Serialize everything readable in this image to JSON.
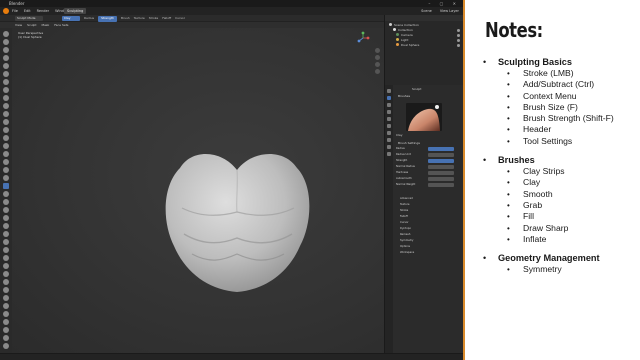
{
  "blender": {
    "title": "Blender",
    "menu": [
      "File",
      "Edit",
      "Render",
      "Window",
      "Help"
    ],
    "workspace": "Sculpting",
    "header_right": [
      "Scene",
      "View Layer"
    ],
    "tool_header": {
      "mode": "Sculpt Mode",
      "brush": "Clay",
      "fields": [
        "Radius",
        "Strength",
        "Brush",
        "Texture",
        "Stroke",
        "Falloff",
        "Cursor"
      ]
    },
    "viewport_header": [
      "View",
      "Sculpt",
      "Mask",
      "Face Sets"
    ],
    "viewport_info": [
      "User Perspective",
      "(1) Dual Sphere"
    ],
    "outliner": [
      {
        "label": "Scene Collection",
        "color": "#cccccc"
      },
      {
        "label": "Collection",
        "color": "#e0e0e0"
      },
      {
        "label": "Camera",
        "color": "#5b8d5b"
      },
      {
        "label": "Light",
        "color": "#d4b04a"
      },
      {
        "label": "Dual Sphere",
        "color": "#e89b40"
      }
    ],
    "properties": {
      "tool_name": "Sculpt",
      "brushes_label": "Brushes",
      "brush_name": "Clay",
      "brush_settings": "Brush Settings",
      "rows": [
        {
          "label": "Radius",
          "value": ""
        },
        {
          "label": "Radius Unit",
          "value": ""
        },
        {
          "label": "Strength",
          "value": ""
        },
        {
          "label": "Normal Radius",
          "value": ""
        },
        {
          "label": "Hardness",
          "value": ""
        },
        {
          "label": "Autosmooth",
          "value": ""
        },
        {
          "label": "Normal Weight",
          "value": ""
        }
      ],
      "panels": [
        "Advanced",
        "Texture",
        "Stroke",
        "Falloff",
        "Cursor",
        "Dyntopo",
        "Remesh",
        "Symmetry",
        "Options",
        "Workspace"
      ]
    },
    "status": [
      "",
      "",
      ""
    ]
  },
  "notes": {
    "title": "Notes:",
    "sections": [
      {
        "label": "Sculpting Basics",
        "items": [
          "Stroke (LMB)",
          "Add/Subtract (Ctrl)",
          "Context Menu",
          "Brush Size (F)",
          "Brush Strength (Shift-F)",
          "Header",
          "Tool Settings"
        ]
      },
      {
        "label": "Brushes",
        "items": [
          "Clay Strips",
          "Clay",
          "Smooth",
          "Grab",
          "Fill",
          "Draw Sharp",
          "Inflate"
        ]
      },
      {
        "label": "Geometry Management",
        "items": [
          "Symmetry"
        ]
      }
    ]
  }
}
